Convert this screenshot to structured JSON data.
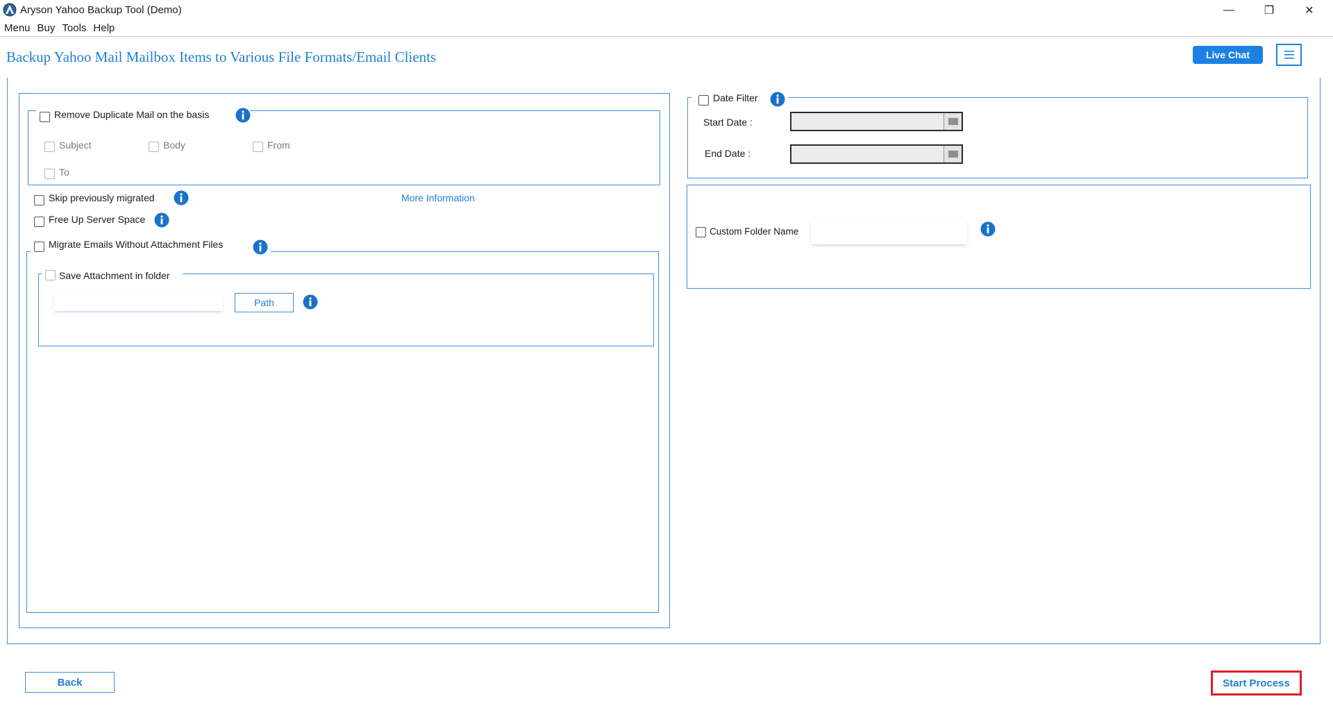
{
  "window": {
    "title": "Aryson Yahoo Backup Tool (Demo)",
    "controls": {
      "minimize": "—",
      "maximize": "❐",
      "close": "✕"
    }
  },
  "menubar": {
    "items": [
      "Menu",
      "Buy",
      "Tools",
      "Help"
    ]
  },
  "header": {
    "title": "Backup Yahoo Mail Mailbox Items to Various File Formats/Email Clients",
    "live_chat_label": "Live Chat"
  },
  "left_panel": {
    "remove_duplicate": {
      "label": "Remove Duplicate Mail on the basis",
      "checked": false,
      "options": [
        "Subject",
        "Body",
        "From",
        "To"
      ]
    },
    "skip_previously_migrated": {
      "label": "Skip previously migrated",
      "checked": false
    },
    "more_information_link": "More Information",
    "free_up_server_space": {
      "label": "Free Up Server Space",
      "checked": false
    },
    "migrate_without_attachments": {
      "label": "Migrate Emails Without Attachment Files",
      "checked": false
    },
    "save_attachment": {
      "label": "Save Attachment in folder",
      "checked": false,
      "path_value": "",
      "path_button_label": "Path"
    }
  },
  "right_panel": {
    "date_filter": {
      "label": "Date Filter",
      "checked": false,
      "start_label": "Start Date :",
      "start_value": "",
      "end_label": "End Date :",
      "end_value": ""
    },
    "custom_folder": {
      "label": "Custom Folder Name",
      "checked": false,
      "value": ""
    }
  },
  "footer": {
    "back_label": "Back",
    "start_label": "Start Process"
  },
  "colors": {
    "accent": "#1e7fd4",
    "border": "#3a8fd8",
    "highlight": "#e01b24"
  }
}
